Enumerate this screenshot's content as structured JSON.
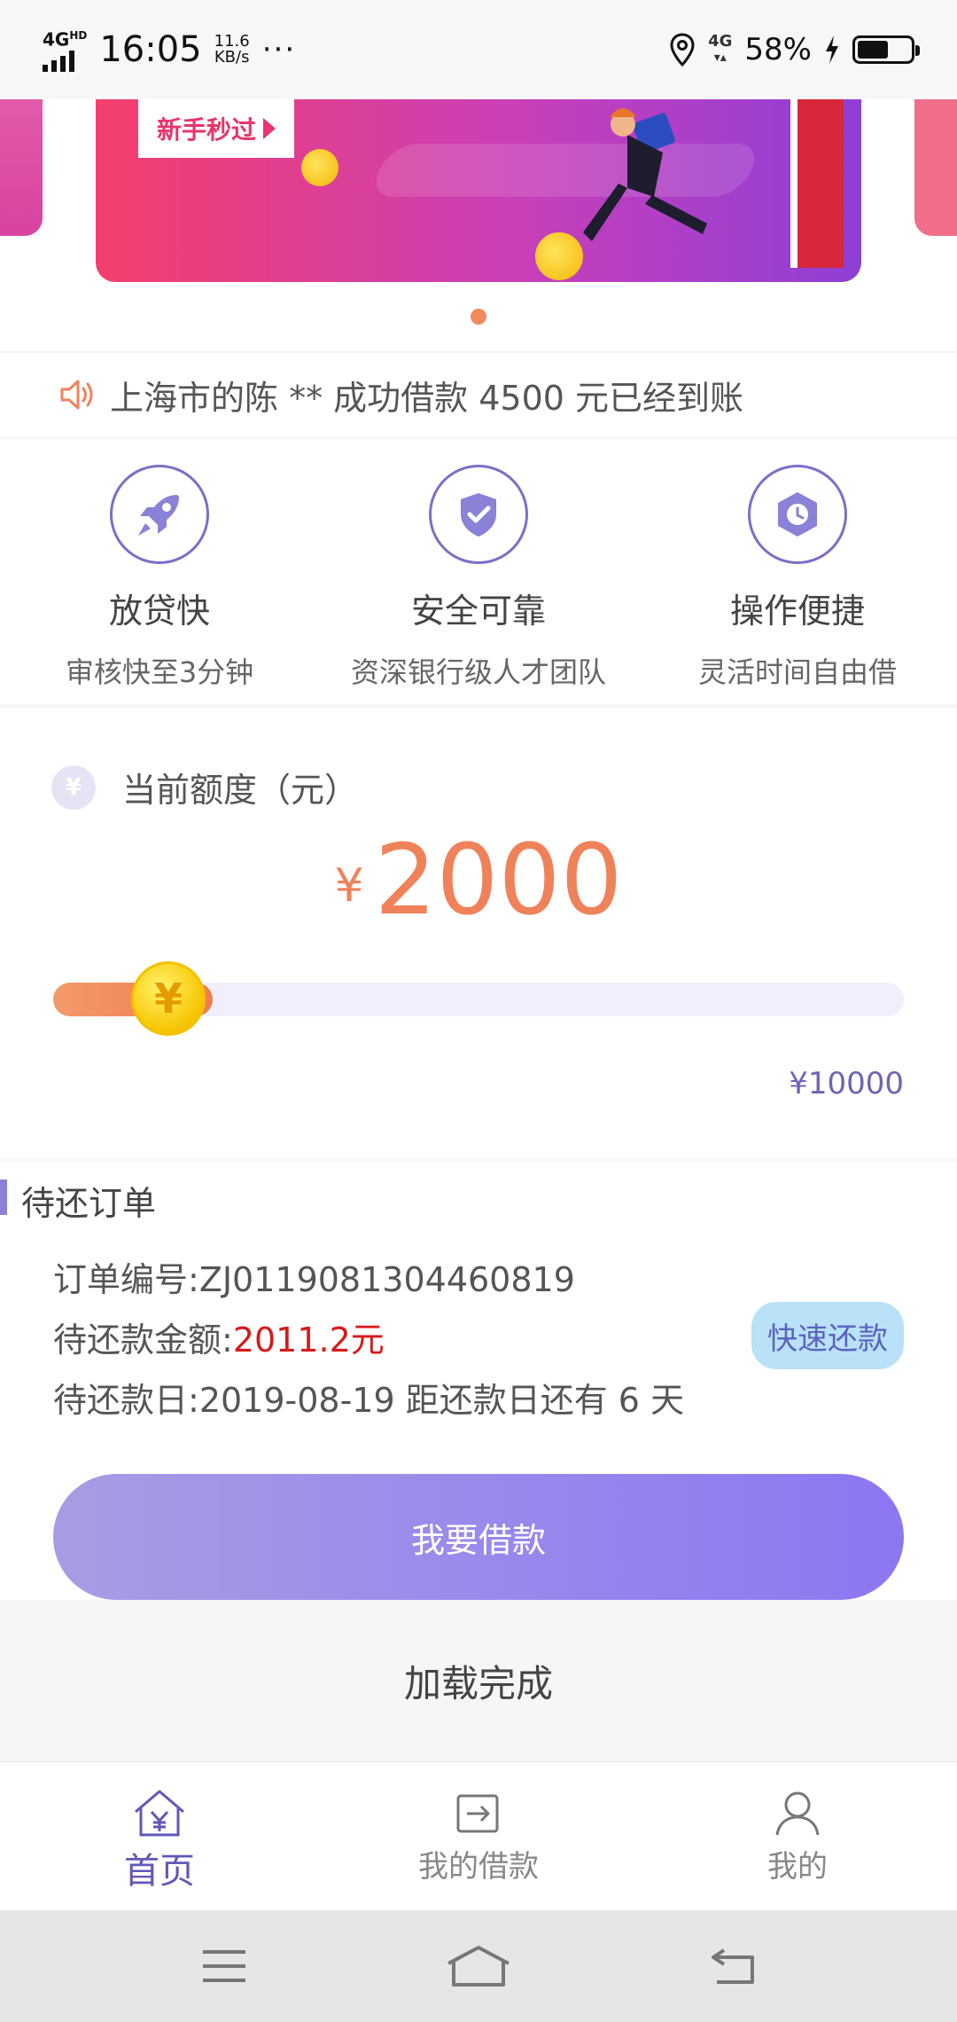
{
  "status_bar": {
    "network": "4G",
    "network_sup": "HD",
    "time": "16:05",
    "speed_value": "11.6",
    "speed_unit": "KB/s",
    "dots": "···",
    "data_label": "4G",
    "battery_percent": "58%",
    "battery_level": 0.58
  },
  "banner": {
    "badge_text": "新手秒过",
    "active_page": 1
  },
  "notice": {
    "icon": "speaker-icon",
    "text": "上海市的陈 ** 成功借款 4500 元已经到账"
  },
  "features": [
    {
      "icon": "rocket-icon",
      "title": "放贷快",
      "subtitle": "审核快至3分钟"
    },
    {
      "icon": "shield-check-icon",
      "title": "安全可靠",
      "subtitle": "资深银行级人才团队"
    },
    {
      "icon": "clock-icon",
      "title": "操作便捷",
      "subtitle": "灵活时间自由借"
    }
  ],
  "quota": {
    "icon_symbol": "¥",
    "label": "当前额度（元）",
    "currency": "¥",
    "amount": "2000",
    "amount_value": 2000,
    "max_label": "¥10000",
    "max_value": 10000,
    "thumb_symbol": "¥"
  },
  "order": {
    "section_title": "待还订单",
    "order_no_label": "订单编号:",
    "order_no": "ZJ0119081304460819",
    "amount_label": "待还款金额:",
    "amount": "2011.2元",
    "due_label": "待还款日:",
    "due_text": "2019-08-19 距还款日还有 6 天",
    "repay_button": "快速还款",
    "borrow_button": "我要借款"
  },
  "loaded_text": "加载完成",
  "tabs": [
    {
      "icon": "home-yen-icon",
      "label": "首页",
      "active": true
    },
    {
      "icon": "my-loans-icon",
      "label": "我的借款",
      "active": false
    },
    {
      "icon": "profile-icon",
      "label": "我的",
      "active": false
    }
  ],
  "colors": {
    "accent_purple": "#6158b8",
    "amount_orange": "#f0825a",
    "debt_red": "#d61a1a",
    "button_gradient_start": "#a69de4",
    "button_gradient_end": "#8d76f2"
  }
}
